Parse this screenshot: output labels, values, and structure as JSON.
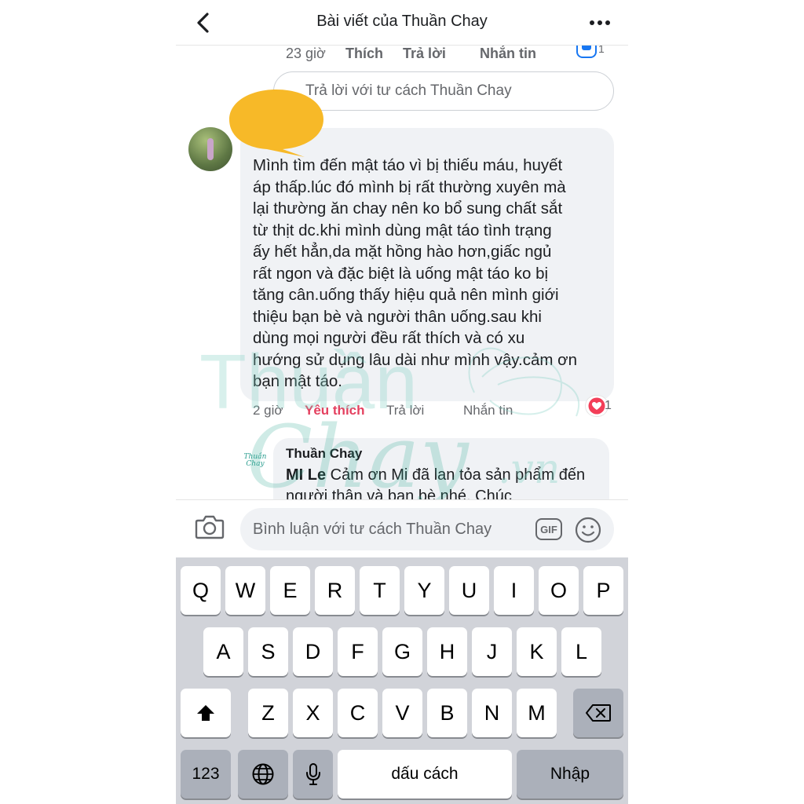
{
  "header": {
    "title": "Bài viết của Thuần Chay"
  },
  "previous_comment": {
    "time": "23 giờ",
    "like_label": "Thích",
    "reply_label": "Trả lời",
    "message_label": "Nhắn tin",
    "reaction_count": "1",
    "reply_placeholder": "Trả lời với tư cách Thuần Chay"
  },
  "comment": {
    "text": "Mình tìm đến mật táo vì bị thiếu máu, huyết\náp thấp.lúc đó mình bị rất thường xuyên mà\nlại thường ăn chay nên ko bổ sung chất sắt\ntừ thịt dc.khi mình dùng mật táo tình trạng\nấy hết hẳn,da mặt hồng hào hơn,giấc ngủ\nrất ngon và đặc biệt là uống mật táo ko bị\ntăng cân.uống thấy hiệu quả nên mình giới\nthiệu bạn bè và người thân uống.sau khi\ndùng mọi người đều rất thích và có xu\nhướng sử dụng lâu dài như mình vậy.cảm ơn\nbạn mật táo.",
    "time": "2 giờ",
    "liked_label": "Yêu thích",
    "reply_label": "Trả lời",
    "message_label": "Nhắn tin",
    "reaction_count": "1"
  },
  "page_reply": {
    "author": "Thuần Chay",
    "mention": "MI Le",
    "text": " Cảm ơn Mi đã lan tỏa sản phẩm đến người thân và bạn bè nhé. Chúc",
    "avatar_logo": "Thuần Chay"
  },
  "watermark": {
    "text_top": "Thuần",
    "text_bottom": "Chay",
    "domain": ".vn"
  },
  "composer": {
    "placeholder": "Bình luận với tư cách Thuần Chay",
    "gif_label": "GIF"
  },
  "keyboard": {
    "row1": [
      "Q",
      "W",
      "E",
      "R",
      "T",
      "Y",
      "U",
      "I",
      "O",
      "P"
    ],
    "row2": [
      "A",
      "S",
      "D",
      "F",
      "G",
      "H",
      "J",
      "K",
      "L"
    ],
    "row3": [
      "Z",
      "X",
      "C",
      "V",
      "B",
      "N",
      "M"
    ],
    "numbers_label": "123",
    "space_label": "dấu cách",
    "return_label": "Nhập"
  },
  "colors": {
    "liked": "#e4405f",
    "bubble": "#f0f2f5",
    "censor_yellow": "#f7b928",
    "watermark": "#7fd0c2",
    "keyboard_bg": "#d1d3d9"
  }
}
